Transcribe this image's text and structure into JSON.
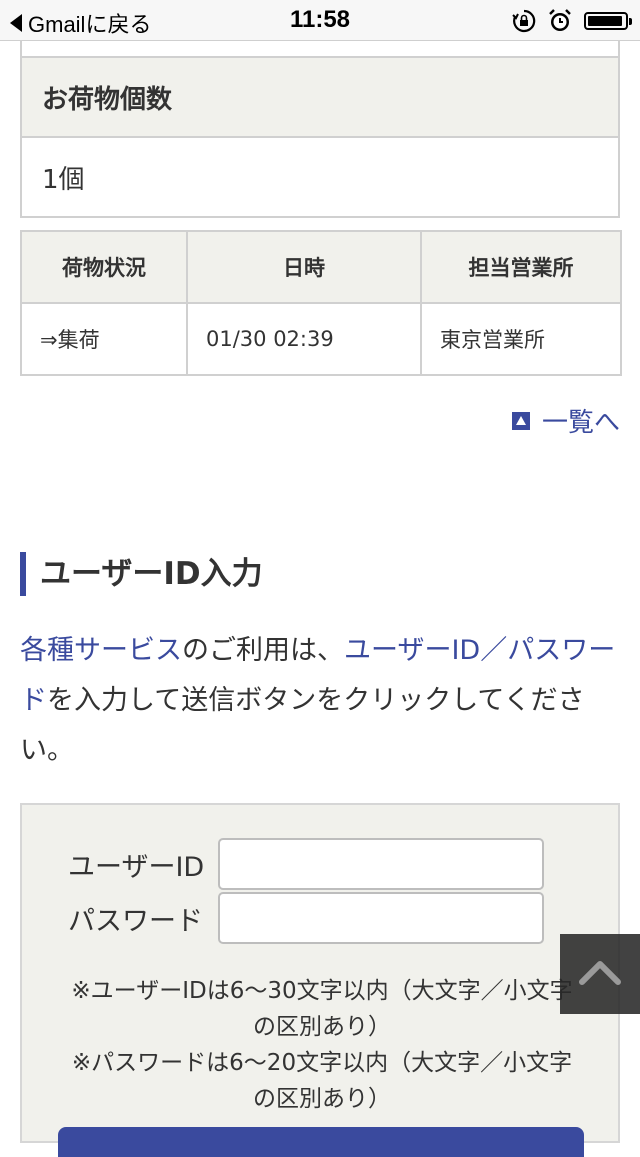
{
  "status_bar": {
    "back_label": "Gmailに戻る",
    "time": "11:58",
    "icons": [
      "orientation-lock-icon",
      "alarm-icon",
      "battery-icon"
    ]
  },
  "package_count": {
    "header": "お荷物個数",
    "value": "1個"
  },
  "tracking_table": {
    "headers": [
      "荷物状況",
      "日時",
      "担当営業所"
    ],
    "rows": [
      [
        "⇒集荷",
        "01/30 02:39",
        "東京営業所"
      ]
    ]
  },
  "list_link": {
    "label": "一覧へ",
    "icon": "up-arrow-icon"
  },
  "login_section": {
    "title": "ユーザーID入力",
    "intro_link1": "各種サービス",
    "intro_text1": "のご利用は、",
    "intro_link2": "ユーザーID／パスワード",
    "intro_text2": "を入力して送信ボタンをクリックしてください。",
    "user_id_label": "ユーザーID",
    "user_id_value": "",
    "password_label": "パスワード",
    "password_value": "",
    "note_user_id": "※ユーザーIDは6〜30文字以内（大文字／小文字の区別あり）",
    "note_password": "※パスワードは6〜20文字以内（大文字／小文字の区別あり）"
  },
  "colors": {
    "accent": "#3a4a9e",
    "table_header_bg": "#f1f1ec",
    "border": "#d0d0d0"
  }
}
